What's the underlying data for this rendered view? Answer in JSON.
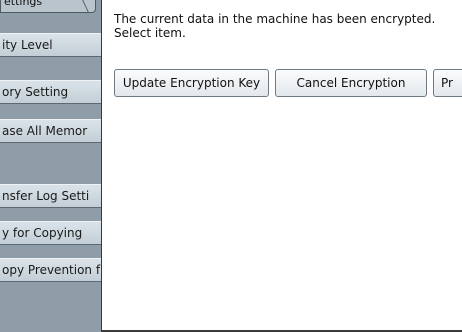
{
  "sidebar": {
    "top_tab": "ettings",
    "items": [
      {
        "label": "ity Level"
      },
      {
        "label": "ory Setting"
      },
      {
        "label": "ase All Memor"
      },
      {
        "label": "nsfer Log Setti"
      },
      {
        "label": "y for Copying"
      },
      {
        "label": "opy Prevention f"
      }
    ]
  },
  "main": {
    "message_line1": "The current data in the machine has been encrypted.",
    "message_line2": "Select item.",
    "buttons": [
      {
        "label": "Update Encryption Key"
      },
      {
        "label": "Cancel Encryption"
      },
      {
        "label": "Pr"
      }
    ]
  }
}
